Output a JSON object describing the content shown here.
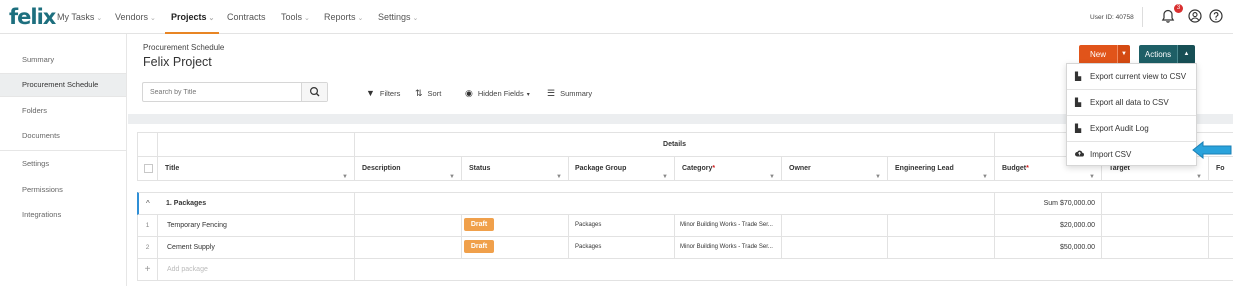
{
  "nav": {
    "logo": "felix",
    "items": [
      {
        "label": "My Tasks",
        "chev": "⌄"
      },
      {
        "label": "Vendors",
        "chev": "⌄"
      },
      {
        "label": "Projects",
        "chev": "⌄"
      },
      {
        "label": "Contracts",
        "chev": ""
      },
      {
        "label": "Tools",
        "chev": "⌄"
      },
      {
        "label": "Reports",
        "chev": "⌄"
      },
      {
        "label": "Settings",
        "chev": "⌄"
      }
    ],
    "user_id": "User ID: 40758",
    "notification_count": "3",
    "accent": "#e88524"
  },
  "sidebar": {
    "items": [
      {
        "label": "Summary"
      },
      {
        "label": "Procurement Schedule"
      },
      {
        "label": "Folders"
      },
      {
        "label": "Documents"
      },
      {
        "label": "Settings"
      },
      {
        "label": "Permissions"
      },
      {
        "label": "Integrations"
      }
    ]
  },
  "header": {
    "breadcrumb": "Procurement Schedule",
    "title": "Felix Project"
  },
  "toolbar": {
    "search_placeholder": "Search by Title",
    "filters": "Filters",
    "sort": "Sort",
    "hidden_fields": "Hidden Fields",
    "summary": "Summary"
  },
  "buttons": {
    "new": "New",
    "actions": "Actions",
    "new_color": "#e1541a",
    "actions_color": "#1e5f66"
  },
  "actions_menu": {
    "items": [
      {
        "label": "Export current view to CSV",
        "icon": "export-file-icon"
      },
      {
        "label": "Export all data to CSV",
        "icon": "export-file-icon"
      },
      {
        "label": "Export Audit Log",
        "icon": "export-file-icon"
      },
      {
        "label": "Import CSV",
        "icon": "cloud-upload-icon"
      }
    ]
  },
  "grid": {
    "group_header": "Details",
    "columns": [
      "Title",
      "Description",
      "Status",
      "Package Group",
      "Category",
      "Owner",
      "Engineering Lead",
      "Budget",
      "Target",
      "Fo"
    ],
    "group": {
      "label": "1. Packages",
      "sum": "Sum $70,000.00"
    },
    "rows": [
      {
        "num": "1",
        "title": "Temporary Fencing",
        "status": "Draft",
        "package_group": "Packages",
        "category": "Minor Building Works - Trade Ser...",
        "budget": "$20,000.00"
      },
      {
        "num": "2",
        "title": "Cement Supply",
        "status": "Draft",
        "package_group": "Packages",
        "category": "Minor Building Works - Trade Ser...",
        "budget": "$50,000.00"
      }
    ],
    "add_label": "Add package"
  }
}
